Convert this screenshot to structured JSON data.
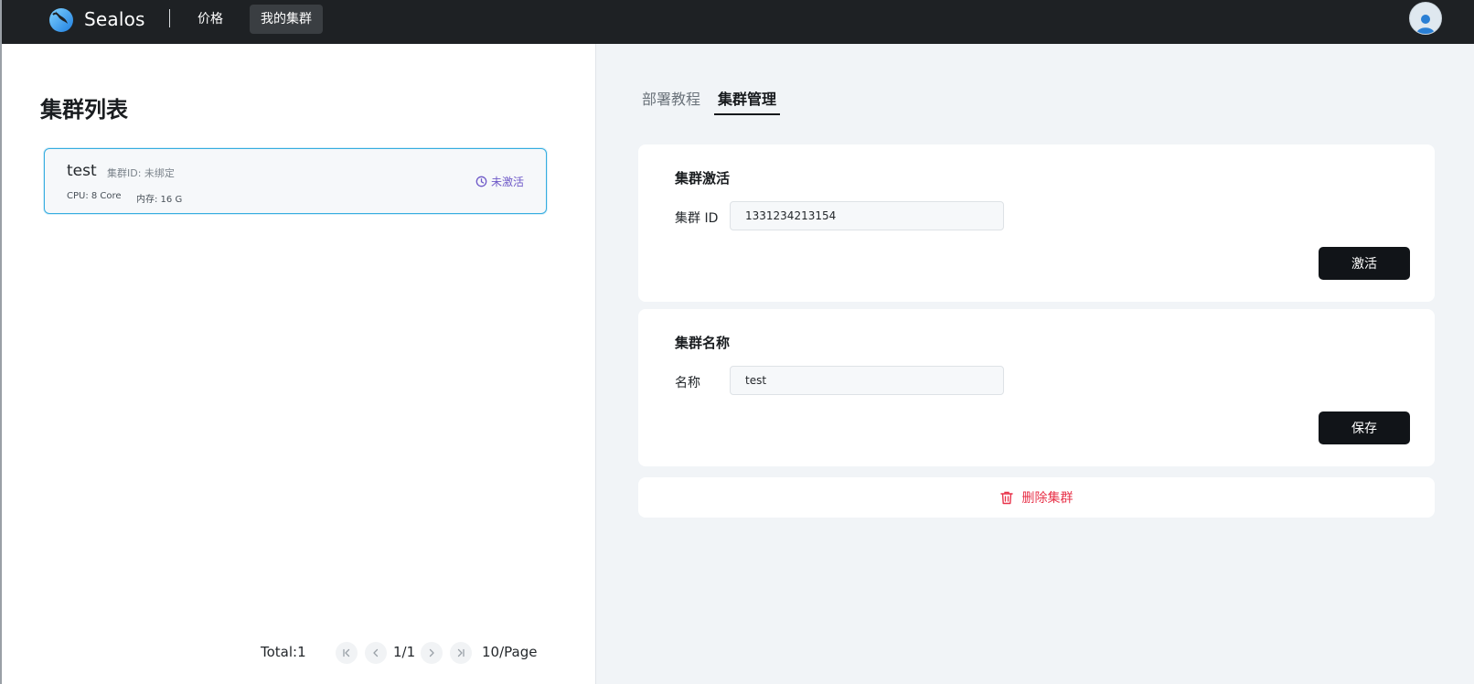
{
  "header": {
    "brand": "Sealos",
    "nav": {
      "pricing": "价格",
      "my_clusters": "我的集群"
    },
    "icons": {
      "logo": "sealos-logo-icon",
      "avatar": "user-avatar-icon"
    }
  },
  "cluster_list": {
    "title": "集群列表",
    "items": [
      {
        "name": "test",
        "cluster_id_text": "集群ID: 未绑定",
        "cpu_text": "CPU: 8 Core",
        "memory_text": "内存: 16 G",
        "status": "未激活",
        "status_icon": "clock-icon"
      }
    ],
    "pagination": {
      "total": "Total:1",
      "current": "1/1",
      "page_size": "10/Page"
    }
  },
  "tabs": [
    {
      "label": "部署教程",
      "active": false
    },
    {
      "label": "集群管理",
      "active": true
    }
  ],
  "activate_card": {
    "title": "集群激活",
    "field_label": "集群 ID",
    "field_value": "1331234213154",
    "button_label": "激活"
  },
  "name_card": {
    "title": "集群名称",
    "field_label": "名称",
    "field_value": "test",
    "button_label": "保存"
  },
  "delete_card": {
    "label": "删除集群",
    "icon": "trash-icon"
  },
  "colors": {
    "topbar": "#1e2124",
    "accent_border": "#36ade0",
    "status_purple": "#6f5ac8",
    "danger": "#e8334a",
    "primary_button": "#111418"
  }
}
